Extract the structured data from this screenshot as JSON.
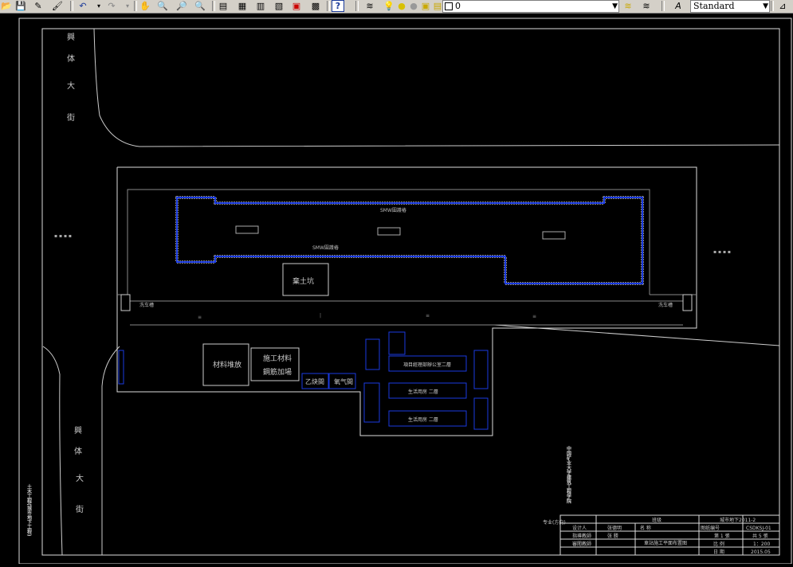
{
  "toolbar": {
    "icons": [
      "open-icon",
      "save-icon",
      "pencil-icon",
      "match-properties-icon",
      "undo-icon",
      "redo-icon",
      "pan-icon",
      "zoom-realtime-icon",
      "zoom-window-icon",
      "zoom-previous-icon",
      "properties-icon",
      "design-center-icon",
      "tool-palettes-icon",
      "sheet-set-icon",
      "markup-icon",
      "calculator-icon",
      "help-icon",
      "layer-manager-icon",
      "layer-on-icon",
      "layer-freeze-icon",
      "layer-lock-icon",
      "layer-color-icon",
      "layer-state-icon",
      "layer-previous-icon",
      "text-style-icon",
      "dimension-icon"
    ],
    "layer_value": "0",
    "text_style_value": "Standard"
  },
  "drawing": {
    "street_west_top": [
      "興",
      "体",
      "大",
      "街"
    ],
    "street_west_bottom": [
      "興",
      "体",
      "大",
      "街"
    ],
    "smw_label_top": "SMW圍護樁",
    "smw_label_mid": "SMW圍護樁",
    "pit_label": "棄土坑",
    "materials_yard": "材料堆放",
    "rebar_yard_1": "施工材料",
    "rebar_yard_2": "鋼筋加場",
    "acetylene_room": "乙炔間",
    "oxygen_room": "氧气間",
    "office_1": "項目經理部辦公室二層",
    "dorm_1": "生活用房  二層",
    "dorm_2": "生活用房  二層",
    "wash_left": "洗车槽",
    "wash_right": "洗车槽",
    "left_edge_title": "土木工程(城市地下工程)",
    "vertical_school": "中国矿业大学建筑工程学院",
    "title_block": {
      "major": "专业(方向)",
      "class_label": "班级",
      "class_value": "城市地下2011-2",
      "drawing_no_label": "图纸编号",
      "drawing_no": "CSDKSJ-01",
      "designer_label": "设计人",
      "designer": "张德明",
      "name_label": "名 称",
      "drawing_name": "車站施工平面布置图",
      "advisor_label": "指導教師",
      "advisor": "张 勝",
      "sheet": "第 1 張",
      "total": "共 5 張",
      "reviewer_label": "審閲教師",
      "scale_label": "比 例",
      "scale_value": "1：200",
      "date_label": "日 期",
      "date_value": "2015.05"
    }
  }
}
